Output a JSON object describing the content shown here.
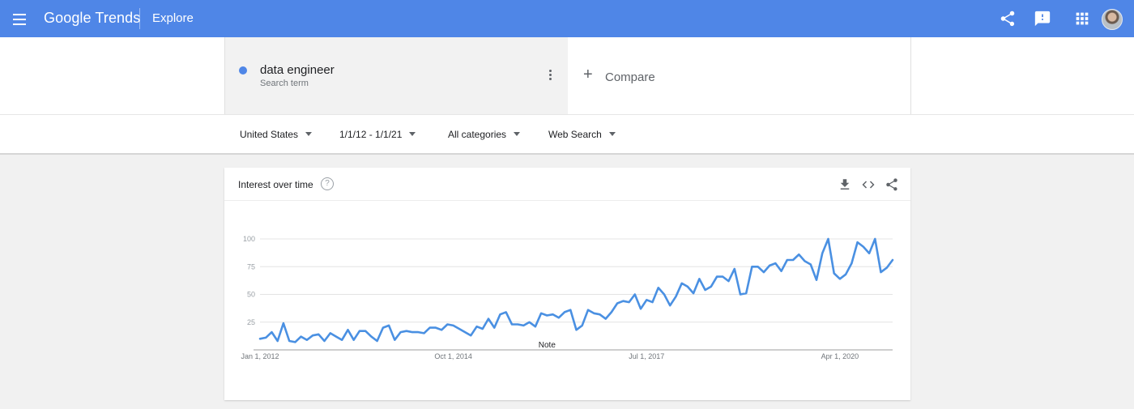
{
  "header": {
    "brand": "Google Trends",
    "page": "Explore",
    "color": "#4f86e7",
    "icons": [
      "menu-icon",
      "share-icon",
      "feedback-icon",
      "apps-icon",
      "avatar"
    ]
  },
  "search_term": {
    "name": "data engineer",
    "sub": "Search term",
    "color": "#4f86e7"
  },
  "compare": {
    "label": "Compare"
  },
  "filters": {
    "region": "United States",
    "date_range": "1/1/12 - 1/1/21",
    "category": "All categories",
    "search_type": "Web Search"
  },
  "card": {
    "title": "Interest over time",
    "icons": [
      "help-icon",
      "download-icon",
      "embed-icon",
      "share-icon"
    ]
  },
  "chart_data": {
    "type": "line",
    "title": "",
    "xlabel": "",
    "ylabel": "",
    "ylim": [
      0,
      100
    ],
    "yticks": [
      25,
      50,
      75,
      100
    ],
    "xticks": [
      "Jan 1, 2012",
      "Oct 1, 2014",
      "Jul 1, 2017",
      "Apr 1, 2020"
    ],
    "grid": true,
    "annotation": "Note",
    "color": "#4a90e2",
    "series": [
      {
        "name": "data engineer",
        "x_start": "2012-01",
        "x_step": "month",
        "values": [
          10,
          11,
          16,
          8,
          24,
          8,
          7,
          12,
          9,
          13,
          14,
          8,
          15,
          12,
          9,
          18,
          9,
          17,
          17,
          12,
          8,
          20,
          22,
          9,
          16,
          17,
          16,
          16,
          15,
          20,
          20,
          18,
          23,
          22,
          19,
          16,
          13,
          21,
          19,
          28,
          20,
          32,
          34,
          23,
          23,
          22,
          25,
          21,
          33,
          31,
          32,
          29,
          34,
          36,
          18,
          22,
          36,
          33,
          32,
          28,
          34,
          42,
          44,
          43,
          50,
          37,
          45,
          43,
          56,
          50,
          40,
          48,
          60,
          57,
          51,
          64,
          54,
          57,
          66,
          66,
          62,
          73,
          50,
          51,
          75,
          75,
          70,
          76,
          78,
          71,
          81,
          81,
          86,
          80,
          77,
          63,
          87,
          100,
          69,
          64,
          68,
          78,
          97,
          93,
          87,
          100,
          70,
          74,
          81
        ]
      }
    ]
  }
}
